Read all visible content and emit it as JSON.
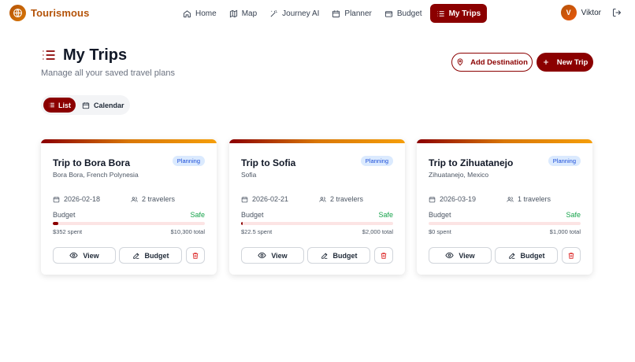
{
  "brand": {
    "name": "Tourismous"
  },
  "nav": {
    "items": [
      {
        "label": "Home",
        "icon": "home-icon"
      },
      {
        "label": "Map",
        "icon": "map-icon"
      },
      {
        "label": "Journey AI",
        "icon": "wand-icon"
      },
      {
        "label": "Planner",
        "icon": "calendar-icon"
      },
      {
        "label": "Budget",
        "icon": "wallet-icon"
      },
      {
        "label": "My Trips",
        "icon": "list-icon",
        "active": true
      }
    ]
  },
  "user": {
    "initial": "V",
    "name": "Viktor"
  },
  "header": {
    "title": "My Trips",
    "subtitle": "Manage all your saved travel plans",
    "add_destination": "Add Destination",
    "new_trip": "New Trip"
  },
  "view_toggle": {
    "list": "List",
    "calendar": "Calendar",
    "selected": "List"
  },
  "trips": [
    {
      "title": "Trip to Bora Bora",
      "location": "Bora Bora, French Polynesia",
      "status": "Planning",
      "date": "2026-02-18",
      "travelers": "2 travelers",
      "budget_label": "Budget",
      "budget_status": "Safe",
      "spent": "$352 spent",
      "total": "$10,300 total",
      "progress_fraction": 0.034,
      "view": "View",
      "budget": "Budget"
    },
    {
      "title": "Trip to Sofia",
      "location": "Sofia",
      "status": "Planning",
      "date": "2026-02-21",
      "travelers": "2 travelers",
      "budget_label": "Budget",
      "budget_status": "Safe",
      "spent": "$22.5 spent",
      "total": "$2,000 total",
      "progress_fraction": 0.011,
      "view": "View",
      "budget": "Budget"
    },
    {
      "title": "Trip to Zihuatanejo",
      "location": "Zihuatanejo, Mexico",
      "status": "Planning",
      "date": "2026-03-19",
      "travelers": "1 travelers",
      "budget_label": "Budget",
      "budget_status": "Safe",
      "spent": "$0 spent",
      "total": "$1,000 total",
      "progress_fraction": 0.0,
      "view": "View",
      "budget": "Budget"
    }
  ],
  "colors": {
    "primary": "#8b0000",
    "accent": "#d97706",
    "safe": "#16a34a",
    "badge_bg": "#dbeafe"
  }
}
